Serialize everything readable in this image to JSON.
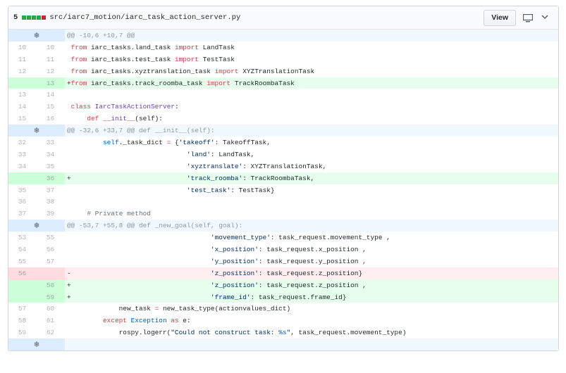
{
  "header": {
    "changes": "5",
    "diffstat": [
      "#28a745",
      "#28a745",
      "#28a745",
      "#28a745",
      "#cb2431"
    ],
    "path": "src/iarc7_motion/iarc_task_action_server.py",
    "view_label": "View",
    "icons": [
      "desktop-icon",
      "chevron-down-icon"
    ]
  },
  "lines": [
    {
      "type": "hunk",
      "text": "@@ -10,6 +10,7 @@"
    },
    {
      "type": "ctx",
      "old": "10",
      "new": "10",
      "m": " ",
      "t": [
        [
          "k",
          "from"
        ],
        [
          "",
          " iarc_tasks.land_task "
        ],
        [
          "k",
          "import"
        ],
        [
          "",
          " LandTask"
        ]
      ]
    },
    {
      "type": "ctx",
      "old": "11",
      "new": "11",
      "m": " ",
      "t": [
        [
          "k",
          "from"
        ],
        [
          "",
          " iarc_tasks.test_task "
        ],
        [
          "k",
          "import"
        ],
        [
          "",
          " TestTask"
        ]
      ]
    },
    {
      "type": "ctx",
      "old": "12",
      "new": "12",
      "m": " ",
      "t": [
        [
          "k",
          "from"
        ],
        [
          "",
          " iarc_tasks.xyztranslation_task "
        ],
        [
          "k",
          "import"
        ],
        [
          "",
          " XYZTranslationTask"
        ]
      ]
    },
    {
      "type": "add",
      "old": "",
      "new": "13",
      "m": "+",
      "t": [
        [
          "k",
          "from"
        ],
        [
          "",
          " iarc_tasks.track_roomba_task "
        ],
        [
          "k",
          "import"
        ],
        [
          "",
          " TrackRoombaTask"
        ]
      ]
    },
    {
      "type": "ctx",
      "old": "13",
      "new": "14",
      "m": " ",
      "t": []
    },
    {
      "type": "ctx",
      "old": "14",
      "new": "15",
      "m": " ",
      "t": [
        [
          "k",
          "class"
        ],
        [
          "",
          " "
        ],
        [
          "e",
          "IarcTaskActionServer"
        ],
        [
          "",
          ":"
        ]
      ]
    },
    {
      "type": "ctx",
      "old": "15",
      "new": "16",
      "m": " ",
      "t": [
        [
          "",
          "    "
        ],
        [
          "k",
          "def"
        ],
        [
          "",
          " "
        ],
        [
          "e",
          "__init__"
        ],
        [
          "",
          "(self):"
        ]
      ]
    },
    {
      "type": "hunk",
      "text": "@@ -32,6 +33,7 @@ def __init__(self):"
    },
    {
      "type": "ctx",
      "old": "32",
      "new": "33",
      "m": " ",
      "t": [
        [
          "",
          "        "
        ],
        [
          "b",
          "self"
        ],
        [
          "",
          "._task_dict "
        ],
        [
          "k",
          "="
        ],
        [
          "",
          " {"
        ],
        [
          "s",
          "'takeoff'"
        ],
        [
          "",
          ": TakeoffTask,"
        ]
      ]
    },
    {
      "type": "ctx",
      "old": "33",
      "new": "34",
      "m": " ",
      "t": [
        [
          "",
          "                             "
        ],
        [
          "s",
          "'land'"
        ],
        [
          "",
          ": LandTask,"
        ]
      ]
    },
    {
      "type": "ctx",
      "old": "34",
      "new": "35",
      "m": " ",
      "t": [
        [
          "",
          "                             "
        ],
        [
          "s",
          "'xyztranslate'"
        ],
        [
          "",
          ": XYZTranslationTask,"
        ]
      ]
    },
    {
      "type": "add",
      "old": "",
      "new": "36",
      "m": "+",
      "t": [
        [
          "",
          "                             "
        ],
        [
          "s",
          "'track_roomba'"
        ],
        [
          "",
          ": TrackRoombaTask,"
        ]
      ]
    },
    {
      "type": "ctx",
      "old": "35",
      "new": "37",
      "m": " ",
      "t": [
        [
          "",
          "                             "
        ],
        [
          "s",
          "'test_task'"
        ],
        [
          "",
          ": TestTask}"
        ]
      ]
    },
    {
      "type": "ctx",
      "old": "36",
      "new": "38",
      "m": " ",
      "t": []
    },
    {
      "type": "ctx",
      "old": "37",
      "new": "39",
      "m": " ",
      "t": [
        [
          "",
          "    "
        ],
        [
          "cm",
          "# Private method"
        ]
      ]
    },
    {
      "type": "hunk",
      "text": "@@ -53,7 +55,8 @@ def _new_goal(self, goal):"
    },
    {
      "type": "ctx",
      "old": "53",
      "new": "55",
      "m": " ",
      "t": [
        [
          "",
          "                                   "
        ],
        [
          "s",
          "'movement_type'"
        ],
        [
          "",
          ": task_request.movement_type ,"
        ]
      ]
    },
    {
      "type": "ctx",
      "old": "54",
      "new": "56",
      "m": " ",
      "t": [
        [
          "",
          "                                   "
        ],
        [
          "s",
          "'x_position'"
        ],
        [
          "",
          ": task_request.x_position ,"
        ]
      ]
    },
    {
      "type": "ctx",
      "old": "55",
      "new": "57",
      "m": " ",
      "t": [
        [
          "",
          "                                   "
        ],
        [
          "s",
          "'y_position'"
        ],
        [
          "",
          ": task_request.y_position ,"
        ]
      ]
    },
    {
      "type": "del",
      "old": "56",
      "new": "",
      "m": "-",
      "t": [
        [
          "",
          "                                   "
        ],
        [
          "s",
          "'z_position'"
        ],
        [
          "",
          ": task_request.z_position}"
        ]
      ]
    },
    {
      "type": "add",
      "old": "",
      "new": "58",
      "m": "+",
      "t": [
        [
          "",
          "                                   "
        ],
        [
          "s",
          "'z_position'"
        ],
        [
          "",
          ": task_request.z_position ,"
        ]
      ]
    },
    {
      "type": "add",
      "old": "",
      "new": "59",
      "m": "+",
      "t": [
        [
          "",
          "                                   "
        ],
        [
          "s",
          "'frame_id'"
        ],
        [
          "",
          ": task_request.frame_id}"
        ]
      ]
    },
    {
      "type": "ctx",
      "old": "57",
      "new": "60",
      "m": " ",
      "t": [
        [
          "",
          "            new_task "
        ],
        [
          "k",
          "="
        ],
        [
          "",
          " new_task_type(actionvalues_dict)"
        ]
      ]
    },
    {
      "type": "ctx",
      "old": "58",
      "new": "61",
      "m": " ",
      "t": [
        [
          "",
          "        "
        ],
        [
          "k",
          "except"
        ],
        [
          "",
          " "
        ],
        [
          "b",
          "Exception"
        ],
        [
          "",
          " "
        ],
        [
          "k",
          "as"
        ],
        [
          "",
          " e:"
        ]
      ]
    },
    {
      "type": "ctx",
      "old": "59",
      "new": "62",
      "m": " ",
      "t": [
        [
          "",
          "            rospy.logerr("
        ],
        [
          "s",
          "\"Could not construct task: "
        ],
        [
          "b",
          "%s"
        ],
        [
          "s",
          "\""
        ],
        [
          "",
          ", task_request.movement_type)"
        ]
      ]
    },
    {
      "type": "hunk",
      "text": ""
    }
  ]
}
